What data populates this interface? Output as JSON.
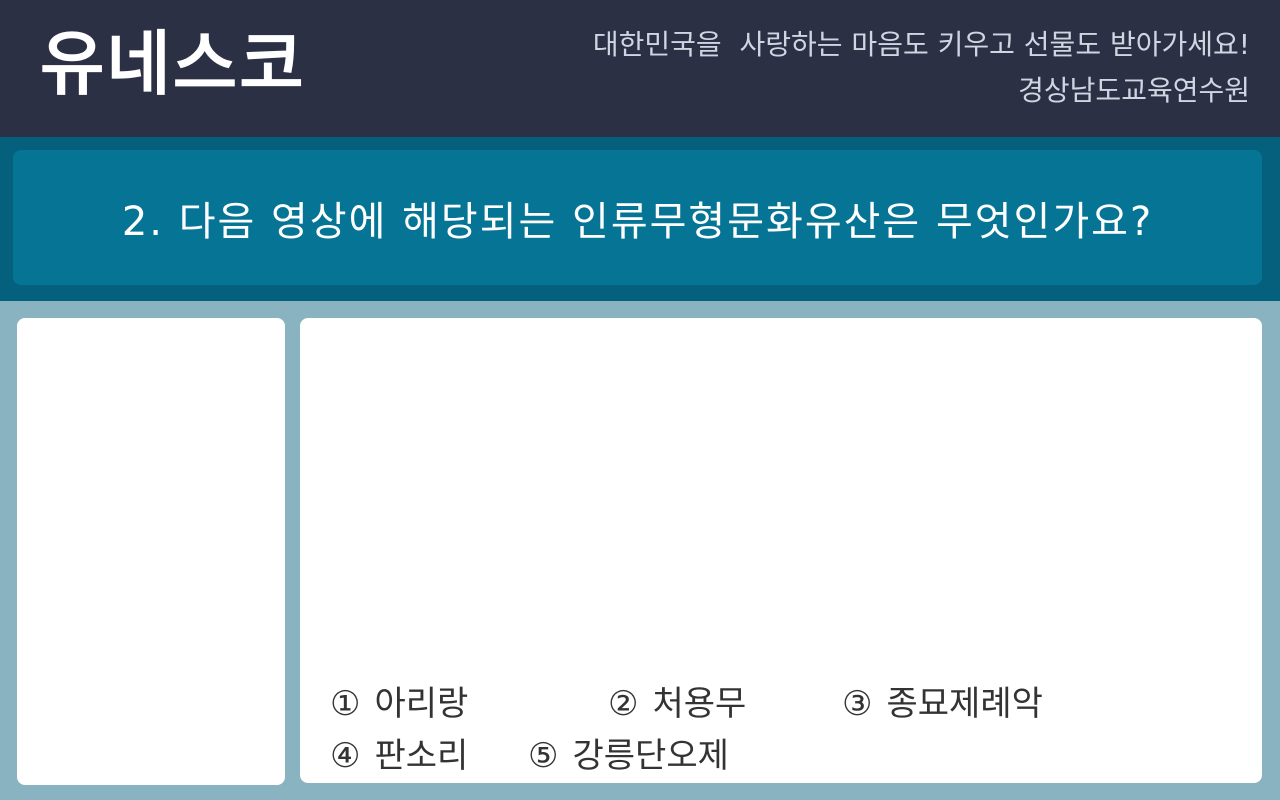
{
  "header": {
    "logo": "유네스코",
    "slogan_line1": "대한민국을  사랑하는 마음도 키우고 선물도 받아가세요!",
    "slogan_line2": "경상남도교육연수원"
  },
  "question": {
    "text": "2. 다음 영상에 해당되는 인류무형문화유산은 무엇인가요?"
  },
  "options": [
    {
      "num": "①",
      "label": "아리랑"
    },
    {
      "num": "②",
      "label": "처용무"
    },
    {
      "num": "③",
      "label": "종묘제례악"
    },
    {
      "num": "④",
      "label": "판소리"
    },
    {
      "num": "⑤",
      "label": "강릉단오제"
    }
  ],
  "colors": {
    "header_bg": "#2b3044",
    "band_bg": "#04607c",
    "question_bg": "#057495",
    "page_bg": "#8ab3c1",
    "panel_bg": "#ffffff"
  }
}
